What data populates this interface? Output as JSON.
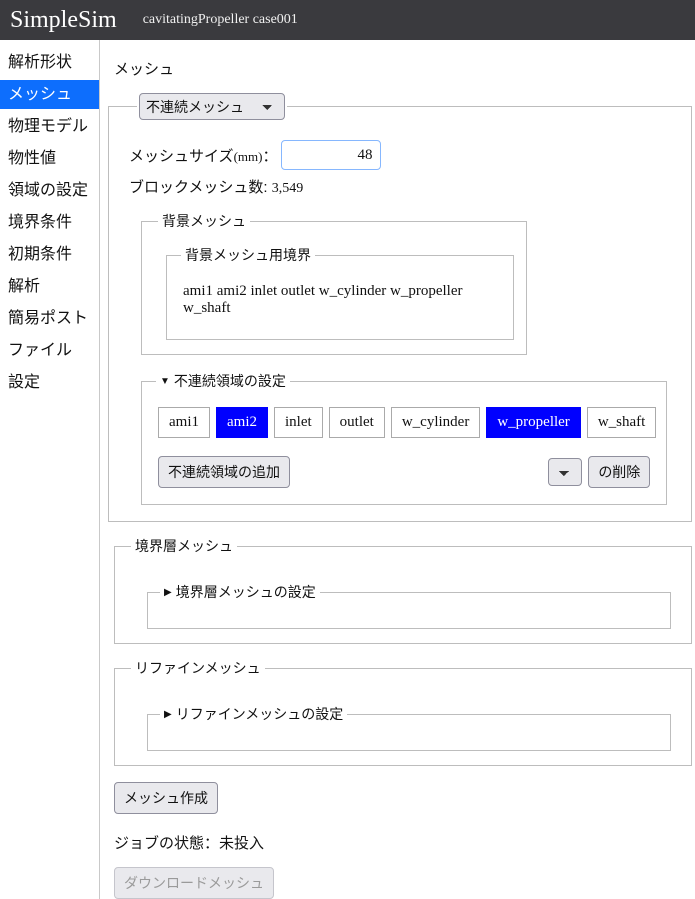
{
  "header": {
    "brand": "SimpleSim",
    "project": "cavitatingPropeller case001"
  },
  "sidebar": {
    "items": [
      {
        "label": "解析形状",
        "active": false
      },
      {
        "label": "メッシュ",
        "active": true
      },
      {
        "label": "物理モデル",
        "active": false
      },
      {
        "label": "物性値",
        "active": false
      },
      {
        "label": "領域の設定",
        "active": false
      },
      {
        "label": "境界条件",
        "active": false
      },
      {
        "label": "初期条件",
        "active": false
      },
      {
        "label": "解析",
        "active": false
      },
      {
        "label": "簡易ポスト",
        "active": false
      },
      {
        "label": "ファイル",
        "active": false
      },
      {
        "label": "設定",
        "active": false
      }
    ]
  },
  "main": {
    "page_title": "メッシュ",
    "mesh_type": {
      "selected": "不連続メッシュ",
      "options": [
        "不連続メッシュ"
      ]
    },
    "mesh_size": {
      "label": "メッシュサイズ",
      "unit": "(mm)",
      "separator": "：",
      "value": "48"
    },
    "block_mesh": {
      "label": "ブロックメッシュ数:",
      "value": "3,549"
    },
    "background_mesh": {
      "legend": "背景メッシュ",
      "boundary_legend": "背景メッシュ用境界",
      "boundaries": "ami1 ami2 inlet outlet w_cylinder w_propeller w_shaft"
    },
    "discontinuous": {
      "marker": "▼",
      "legend": "不連続領域の設定",
      "chips": [
        {
          "label": "ami1",
          "selected": false
        },
        {
          "label": "ami2",
          "selected": true
        },
        {
          "label": "inlet",
          "selected": false
        },
        {
          "label": "outlet",
          "selected": false
        },
        {
          "label": "w_cylinder",
          "selected": false
        },
        {
          "label": "w_propeller",
          "selected": true
        },
        {
          "label": "w_shaft",
          "selected": false
        }
      ],
      "add_button": "不連続領域の追加",
      "delete_select_value": "",
      "delete_button": "の削除"
    },
    "boundary_layer": {
      "legend": "境界層メッシュ",
      "inner_marker": "▶",
      "inner_legend": "境界層メッシュの設定"
    },
    "refine_mesh": {
      "legend": "リファインメッシュ",
      "inner_marker": "▶",
      "inner_legend": "リファインメッシュの設定"
    },
    "bottom": {
      "create_button": "メッシュ作成",
      "job_status": "ジョブの状態：未投入",
      "download_button": "ダウンロードメッシュ"
    }
  },
  "colors": {
    "header_bg": "#3a3a3e",
    "sidebar_active": "#0d6efd",
    "chip_selected": "#0000ff",
    "input_border": "#86b7fe"
  }
}
